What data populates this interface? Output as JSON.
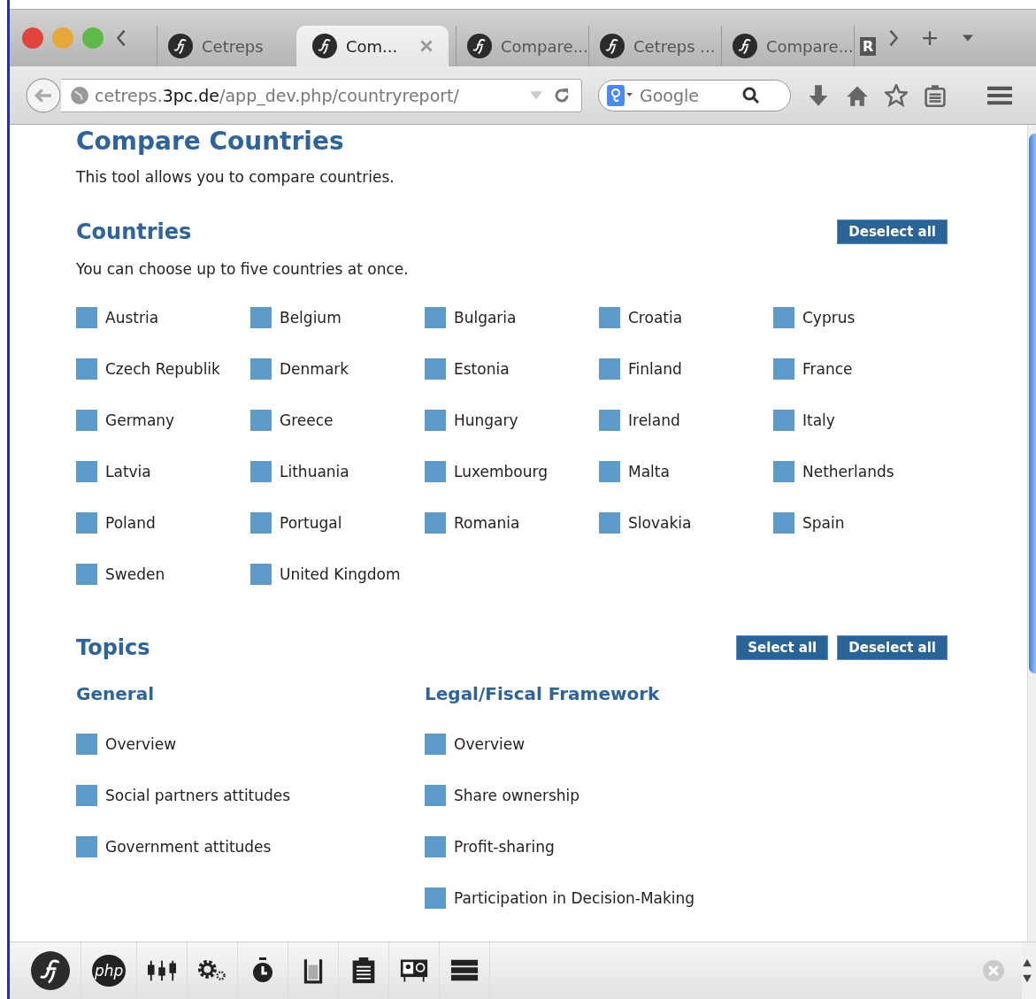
{
  "tabs": [
    {
      "label": "Cetreps",
      "selected": false
    },
    {
      "label": "Com...",
      "selected": true,
      "closable": true
    },
    {
      "label": "Compare...",
      "selected": false
    },
    {
      "label": "Cetreps ...",
      "selected": false
    },
    {
      "label": "Compare...",
      "selected": false
    }
  ],
  "overflow_tab": {
    "label": "R"
  },
  "address_bar": {
    "host_pre": "cetreps.",
    "domain": "3pc.de",
    "path": "/app_dev.php/countryreport/"
  },
  "search": {
    "placeholder": "Google"
  },
  "page": {
    "title": "Compare Countries",
    "intro": "This tool allows you to compare countries.",
    "countries": {
      "heading": "Countries",
      "buttons": [
        "Deselect all"
      ],
      "note": "You can choose up to five countries at once.",
      "items": [
        {
          "label": "Austria",
          "checked": false
        },
        {
          "label": "Belgium",
          "checked": false
        },
        {
          "label": "Bulgaria",
          "checked": false
        },
        {
          "label": "Croatia",
          "checked": false
        },
        {
          "label": "Cyprus",
          "checked": false
        },
        {
          "label": "Czech Republik",
          "checked": false
        },
        {
          "label": "Denmark",
          "checked": false
        },
        {
          "label": "Estonia",
          "checked": false
        },
        {
          "label": "Finland",
          "checked": false
        },
        {
          "label": "France",
          "checked": false
        },
        {
          "label": "Germany",
          "checked": false
        },
        {
          "label": "Greece",
          "checked": false
        },
        {
          "label": "Hungary",
          "checked": false
        },
        {
          "label": "Ireland",
          "checked": false
        },
        {
          "label": "Italy",
          "checked": false
        },
        {
          "label": "Latvia",
          "checked": false
        },
        {
          "label": "Lithuania",
          "checked": false
        },
        {
          "label": "Luxembourg",
          "checked": false
        },
        {
          "label": "Malta",
          "checked": false
        },
        {
          "label": "Netherlands",
          "checked": false
        },
        {
          "label": "Poland",
          "checked": false
        },
        {
          "label": "Portugal",
          "checked": false
        },
        {
          "label": "Romania",
          "checked": false
        },
        {
          "label": "Slovakia",
          "checked": false
        },
        {
          "label": "Spain",
          "checked": false
        },
        {
          "label": "Sweden",
          "checked": false
        },
        {
          "label": "United Kingdom",
          "checked": false
        }
      ]
    },
    "topics": {
      "heading": "Topics",
      "buttons": [
        "Select all",
        "Deselect all"
      ],
      "groups": [
        {
          "heading": "General",
          "items": [
            {
              "label": "Overview",
              "checked": false
            },
            {
              "label": "Social partners attitudes",
              "checked": false
            },
            {
              "label": "Government attitudes",
              "checked": false
            }
          ]
        },
        {
          "heading": "Legal/Fiscal Framework",
          "items": [
            {
              "label": "Overview",
              "checked": false
            },
            {
              "label": "Share ownership",
              "checked": false
            },
            {
              "label": "Profit-sharing",
              "checked": false
            },
            {
              "label": "Participation in Decision-Making",
              "checked": false
            }
          ]
        }
      ]
    }
  },
  "debug_toolbar": [
    {
      "kind": "symfony"
    },
    {
      "kind": "php",
      "label": "php"
    },
    {
      "kind": "config"
    },
    {
      "kind": "gears"
    },
    {
      "kind": "timer"
    },
    {
      "kind": "memory"
    },
    {
      "kind": "clipboard"
    },
    {
      "kind": "mail"
    },
    {
      "kind": "database"
    }
  ]
}
